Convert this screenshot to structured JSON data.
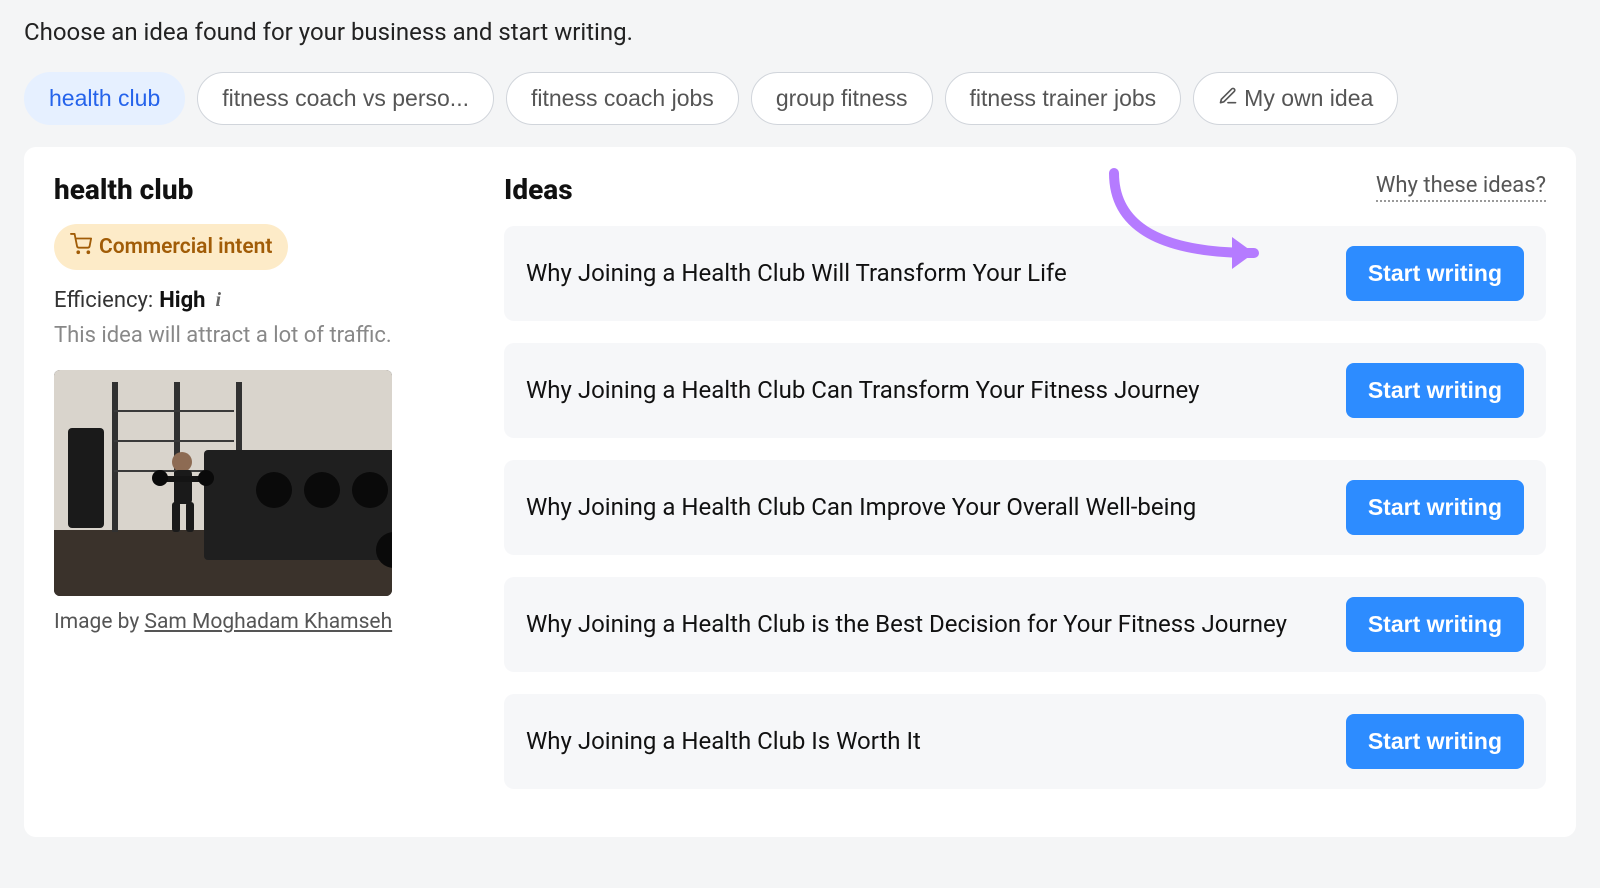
{
  "header": {
    "subtitle": "Choose an idea found for your business and start writing."
  },
  "chips": [
    {
      "label": "health club",
      "active": true
    },
    {
      "label": "fitness coach vs perso...",
      "active": false
    },
    {
      "label": "fitness coach jobs",
      "active": false
    },
    {
      "label": "group fitness",
      "active": false
    },
    {
      "label": "fitness trainer jobs",
      "active": false
    },
    {
      "label": "My own idea",
      "active": false,
      "icon": "pen"
    }
  ],
  "topic": {
    "title": "health club",
    "intent_label": "Commercial intent",
    "efficiency_label": "Efficiency:",
    "efficiency_value": "High",
    "description": "This idea will attract a lot of traffic.",
    "image_credit_prefix": "Image by ",
    "image_credit_author": "Sam Moghadam Khamseh"
  },
  "ideas": {
    "heading": "Ideas",
    "why_link": "Why these ideas?",
    "items": [
      {
        "title": "Why Joining a Health Club Will Transform Your Life",
        "button": "Start writing"
      },
      {
        "title": "Why Joining a Health Club Can Transform Your Fitness Journey",
        "button": "Start writing"
      },
      {
        "title": "Why Joining a Health Club Can Improve Your Overall Well-being",
        "button": "Start writing"
      },
      {
        "title": "Why Joining a Health Club is the Best Decision for Your Fitness Journey",
        "button": "Start writing"
      },
      {
        "title": "Why Joining a Health Club Is Worth It",
        "button": "Start writing"
      }
    ]
  }
}
